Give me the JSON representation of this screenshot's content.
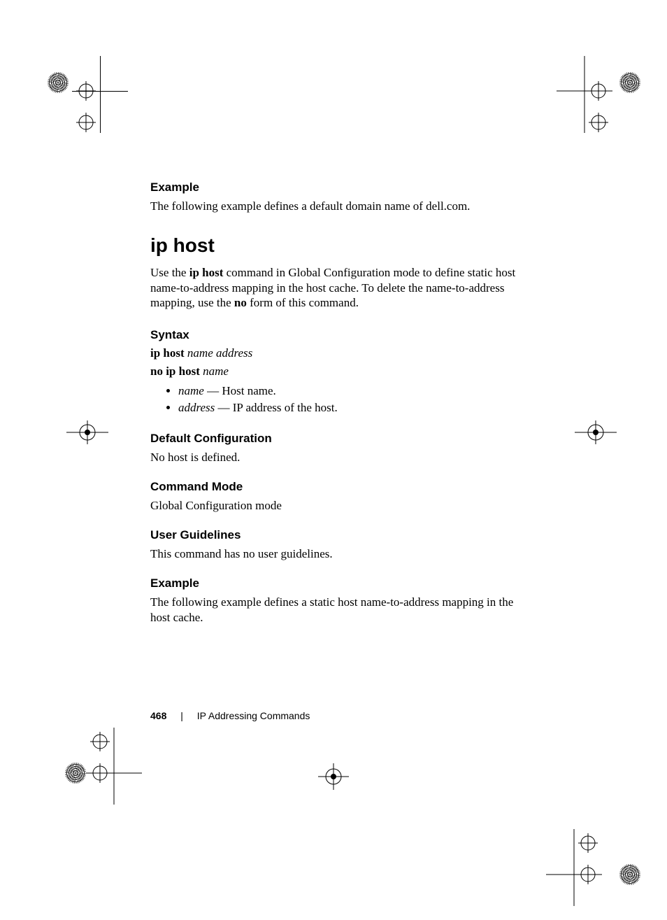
{
  "sections": {
    "example1": {
      "heading": "Example",
      "text": "The following example defines a default domain name of dell.com."
    },
    "title": "ip host",
    "intro_parts": {
      "pre": "Use the ",
      "cmd": "ip host",
      "mid": " command in Global Configuration mode to define static host name-to-address mapping in the host cache. To delete the name-to-address mapping, use the ",
      "no": "no",
      "post": " form of this command."
    },
    "syntax": {
      "heading": "Syntax",
      "line1": {
        "bold": "ip host ",
        "italic": "name address"
      },
      "line2": {
        "bold": "no ip host ",
        "italic": "name"
      },
      "params": [
        {
          "term": "name",
          "desc": " — Host name."
        },
        {
          "term": "address",
          "desc": " — IP address of the host."
        }
      ]
    },
    "default_cfg": {
      "heading": "Default Configuration",
      "text": "No host is defined."
    },
    "cmd_mode": {
      "heading": "Command Mode",
      "text": "Global Configuration mode"
    },
    "guidelines": {
      "heading": "User Guidelines",
      "text": "This command has no user guidelines."
    },
    "example2": {
      "heading": "Example",
      "text": "The following example defines a static host name-to-address mapping in the host cache."
    }
  },
  "footer": {
    "page": "468",
    "section": "IP Addressing Commands"
  }
}
